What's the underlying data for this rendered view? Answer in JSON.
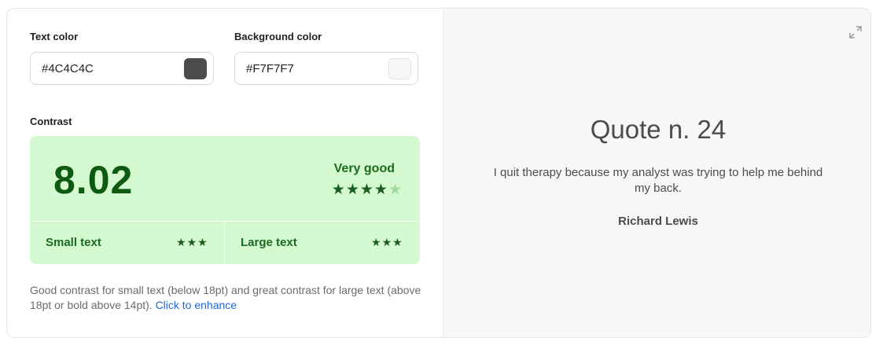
{
  "text_color": {
    "label": "Text color",
    "value": "#4C4C4C",
    "swatch": "#4C4C4C"
  },
  "background_color": {
    "label": "Background color",
    "value": "#F7F7F7",
    "swatch": "#F7F7F7"
  },
  "contrast": {
    "label": "Contrast",
    "score": "8.02",
    "rating": "Very good",
    "rating_stars_filled": 4,
    "rating_stars_total": 5,
    "small_text": {
      "label": "Small text",
      "stars": 3
    },
    "large_text": {
      "label": "Large text",
      "stars": 3
    },
    "box_color": "#D4F8D0",
    "accent_color": "#1B5E1F"
  },
  "description": {
    "text": "Good contrast for small text (below 18pt) and great contrast for large text (above 18pt or bold above 14pt).",
    "link": "Click to enhance",
    "link_color": "#1F66D8"
  },
  "preview": {
    "expand_icon": "expand-icon",
    "title": "Quote n. 24",
    "quote": "I quit therapy because my analyst was trying to help me behind my back.",
    "author": "Richard Lewis",
    "background": "#F7F7F7",
    "text": "#4C4C4C"
  }
}
